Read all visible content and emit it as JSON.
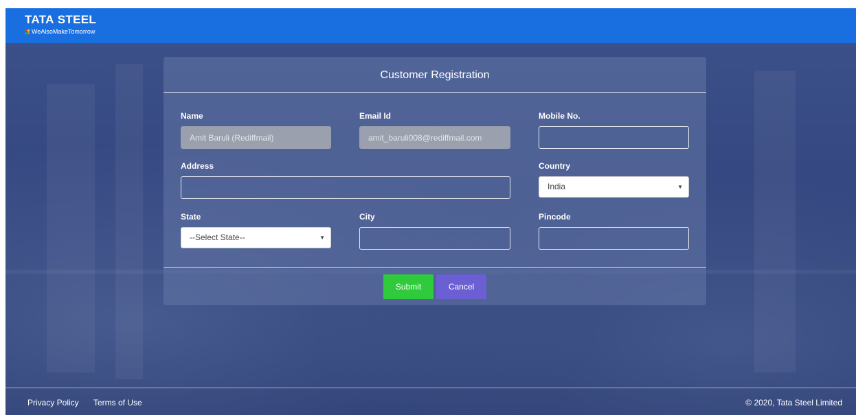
{
  "brand": {
    "name_bold": "TATA",
    "name_rest": " STEEL",
    "tagline": "WeAlsoMakeTomorrow"
  },
  "form": {
    "title": "Customer Registration",
    "fields": {
      "name": {
        "label": "Name",
        "value": "Amit Baruli (Rediffmail)"
      },
      "email": {
        "label": "Email Id",
        "value": "amit_baruli008@rediffmail.com"
      },
      "mobile": {
        "label": "Mobile No.",
        "value": ""
      },
      "address": {
        "label": "Address",
        "value": ""
      },
      "country": {
        "label": "Country",
        "selected": "India"
      },
      "state": {
        "label": "State",
        "selected": "--Select State--"
      },
      "city": {
        "label": "City",
        "value": ""
      },
      "pincode": {
        "label": "Pincode",
        "value": ""
      }
    },
    "submit_label": "Submit",
    "cancel_label": "Cancel"
  },
  "footer": {
    "privacy": "Privacy Policy",
    "terms": "Terms of Use",
    "copyright": "© 2020, Tata Steel Limited"
  },
  "colors": {
    "header": "#1a6fe0",
    "submit": "#2fcb3c",
    "cancel": "#6c5fd3",
    "background": "#344780"
  }
}
